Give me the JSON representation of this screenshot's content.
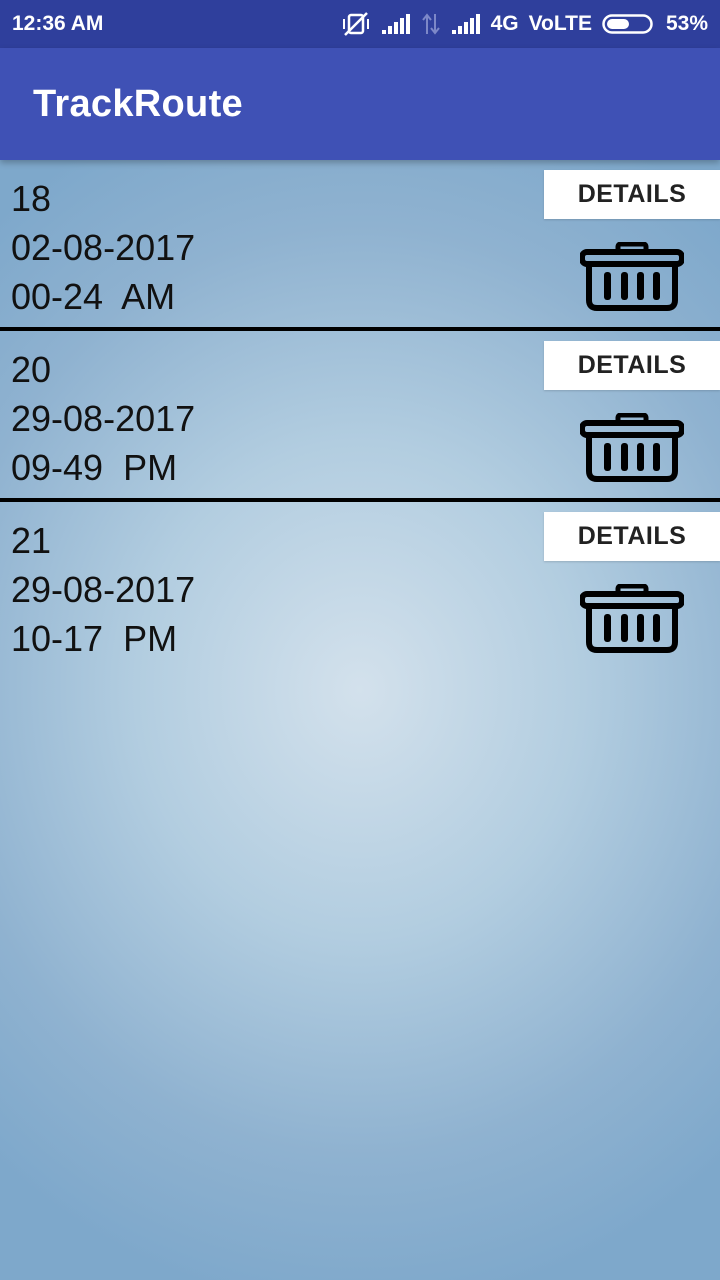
{
  "status_bar": {
    "time": "12:36 AM",
    "network": "4G",
    "volte": "VoLTE",
    "battery_percent": "53%",
    "battery_level": 0.53,
    "icons": [
      "vibrate-off-icon",
      "signal-icon",
      "data-arrows-icon",
      "signal-icon",
      "battery-icon"
    ]
  },
  "app_bar": {
    "title": "TrackRoute"
  },
  "routes": [
    {
      "id": "18",
      "date": "02-08-2017",
      "time": "00-24  AM",
      "details_label": "DETAILS",
      "delete_icon": "trash-icon"
    },
    {
      "id": "20",
      "date": "29-08-2017",
      "time": "09-49  PM",
      "details_label": "DETAILS",
      "delete_icon": "trash-icon"
    },
    {
      "id": "21",
      "date": "29-08-2017",
      "time": "10-17  PM",
      "details_label": "DETAILS",
      "delete_icon": "trash-icon"
    }
  ],
  "colors": {
    "status_bar": "#2f3f9c",
    "app_bar": "#3f51b5",
    "background_center": "#d3e1ec",
    "background_edge": "#7ea8cb",
    "divider": "#000000"
  }
}
